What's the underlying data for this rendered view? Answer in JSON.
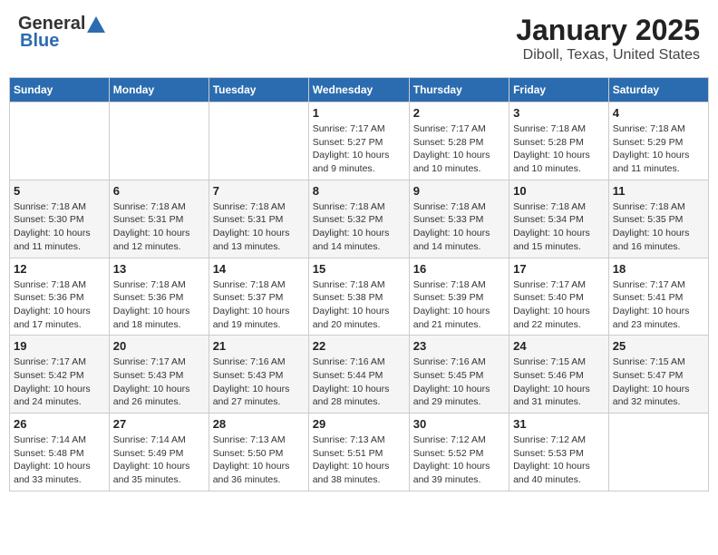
{
  "header": {
    "logo_line1": "General",
    "logo_line2": "Blue",
    "month": "January 2025",
    "location": "Diboll, Texas, United States"
  },
  "days_of_week": [
    "Sunday",
    "Monday",
    "Tuesday",
    "Wednesday",
    "Thursday",
    "Friday",
    "Saturday"
  ],
  "weeks": [
    [
      {
        "day": "",
        "sunrise": "",
        "sunset": "",
        "daylight": ""
      },
      {
        "day": "",
        "sunrise": "",
        "sunset": "",
        "daylight": ""
      },
      {
        "day": "",
        "sunrise": "",
        "sunset": "",
        "daylight": ""
      },
      {
        "day": "1",
        "sunrise": "Sunrise: 7:17 AM",
        "sunset": "Sunset: 5:27 PM",
        "daylight": "Daylight: 10 hours and 9 minutes."
      },
      {
        "day": "2",
        "sunrise": "Sunrise: 7:17 AM",
        "sunset": "Sunset: 5:28 PM",
        "daylight": "Daylight: 10 hours and 10 minutes."
      },
      {
        "day": "3",
        "sunrise": "Sunrise: 7:18 AM",
        "sunset": "Sunset: 5:28 PM",
        "daylight": "Daylight: 10 hours and 10 minutes."
      },
      {
        "day": "4",
        "sunrise": "Sunrise: 7:18 AM",
        "sunset": "Sunset: 5:29 PM",
        "daylight": "Daylight: 10 hours and 11 minutes."
      }
    ],
    [
      {
        "day": "5",
        "sunrise": "Sunrise: 7:18 AM",
        "sunset": "Sunset: 5:30 PM",
        "daylight": "Daylight: 10 hours and 11 minutes."
      },
      {
        "day": "6",
        "sunrise": "Sunrise: 7:18 AM",
        "sunset": "Sunset: 5:31 PM",
        "daylight": "Daylight: 10 hours and 12 minutes."
      },
      {
        "day": "7",
        "sunrise": "Sunrise: 7:18 AM",
        "sunset": "Sunset: 5:31 PM",
        "daylight": "Daylight: 10 hours and 13 minutes."
      },
      {
        "day": "8",
        "sunrise": "Sunrise: 7:18 AM",
        "sunset": "Sunset: 5:32 PM",
        "daylight": "Daylight: 10 hours and 14 minutes."
      },
      {
        "day": "9",
        "sunrise": "Sunrise: 7:18 AM",
        "sunset": "Sunset: 5:33 PM",
        "daylight": "Daylight: 10 hours and 14 minutes."
      },
      {
        "day": "10",
        "sunrise": "Sunrise: 7:18 AM",
        "sunset": "Sunset: 5:34 PM",
        "daylight": "Daylight: 10 hours and 15 minutes."
      },
      {
        "day": "11",
        "sunrise": "Sunrise: 7:18 AM",
        "sunset": "Sunset: 5:35 PM",
        "daylight": "Daylight: 10 hours and 16 minutes."
      }
    ],
    [
      {
        "day": "12",
        "sunrise": "Sunrise: 7:18 AM",
        "sunset": "Sunset: 5:36 PM",
        "daylight": "Daylight: 10 hours and 17 minutes."
      },
      {
        "day": "13",
        "sunrise": "Sunrise: 7:18 AM",
        "sunset": "Sunset: 5:36 PM",
        "daylight": "Daylight: 10 hours and 18 minutes."
      },
      {
        "day": "14",
        "sunrise": "Sunrise: 7:18 AM",
        "sunset": "Sunset: 5:37 PM",
        "daylight": "Daylight: 10 hours and 19 minutes."
      },
      {
        "day": "15",
        "sunrise": "Sunrise: 7:18 AM",
        "sunset": "Sunset: 5:38 PM",
        "daylight": "Daylight: 10 hours and 20 minutes."
      },
      {
        "day": "16",
        "sunrise": "Sunrise: 7:18 AM",
        "sunset": "Sunset: 5:39 PM",
        "daylight": "Daylight: 10 hours and 21 minutes."
      },
      {
        "day": "17",
        "sunrise": "Sunrise: 7:17 AM",
        "sunset": "Sunset: 5:40 PM",
        "daylight": "Daylight: 10 hours and 22 minutes."
      },
      {
        "day": "18",
        "sunrise": "Sunrise: 7:17 AM",
        "sunset": "Sunset: 5:41 PM",
        "daylight": "Daylight: 10 hours and 23 minutes."
      }
    ],
    [
      {
        "day": "19",
        "sunrise": "Sunrise: 7:17 AM",
        "sunset": "Sunset: 5:42 PM",
        "daylight": "Daylight: 10 hours and 24 minutes."
      },
      {
        "day": "20",
        "sunrise": "Sunrise: 7:17 AM",
        "sunset": "Sunset: 5:43 PM",
        "daylight": "Daylight: 10 hours and 26 minutes."
      },
      {
        "day": "21",
        "sunrise": "Sunrise: 7:16 AM",
        "sunset": "Sunset: 5:43 PM",
        "daylight": "Daylight: 10 hours and 27 minutes."
      },
      {
        "day": "22",
        "sunrise": "Sunrise: 7:16 AM",
        "sunset": "Sunset: 5:44 PM",
        "daylight": "Daylight: 10 hours and 28 minutes."
      },
      {
        "day": "23",
        "sunrise": "Sunrise: 7:16 AM",
        "sunset": "Sunset: 5:45 PM",
        "daylight": "Daylight: 10 hours and 29 minutes."
      },
      {
        "day": "24",
        "sunrise": "Sunrise: 7:15 AM",
        "sunset": "Sunset: 5:46 PM",
        "daylight": "Daylight: 10 hours and 31 minutes."
      },
      {
        "day": "25",
        "sunrise": "Sunrise: 7:15 AM",
        "sunset": "Sunset: 5:47 PM",
        "daylight": "Daylight: 10 hours and 32 minutes."
      }
    ],
    [
      {
        "day": "26",
        "sunrise": "Sunrise: 7:14 AM",
        "sunset": "Sunset: 5:48 PM",
        "daylight": "Daylight: 10 hours and 33 minutes."
      },
      {
        "day": "27",
        "sunrise": "Sunrise: 7:14 AM",
        "sunset": "Sunset: 5:49 PM",
        "daylight": "Daylight: 10 hours and 35 minutes."
      },
      {
        "day": "28",
        "sunrise": "Sunrise: 7:13 AM",
        "sunset": "Sunset: 5:50 PM",
        "daylight": "Daylight: 10 hours and 36 minutes."
      },
      {
        "day": "29",
        "sunrise": "Sunrise: 7:13 AM",
        "sunset": "Sunset: 5:51 PM",
        "daylight": "Daylight: 10 hours and 38 minutes."
      },
      {
        "day": "30",
        "sunrise": "Sunrise: 7:12 AM",
        "sunset": "Sunset: 5:52 PM",
        "daylight": "Daylight: 10 hours and 39 minutes."
      },
      {
        "day": "31",
        "sunrise": "Sunrise: 7:12 AM",
        "sunset": "Sunset: 5:53 PM",
        "daylight": "Daylight: 10 hours and 40 minutes."
      },
      {
        "day": "",
        "sunrise": "",
        "sunset": "",
        "daylight": ""
      }
    ]
  ]
}
